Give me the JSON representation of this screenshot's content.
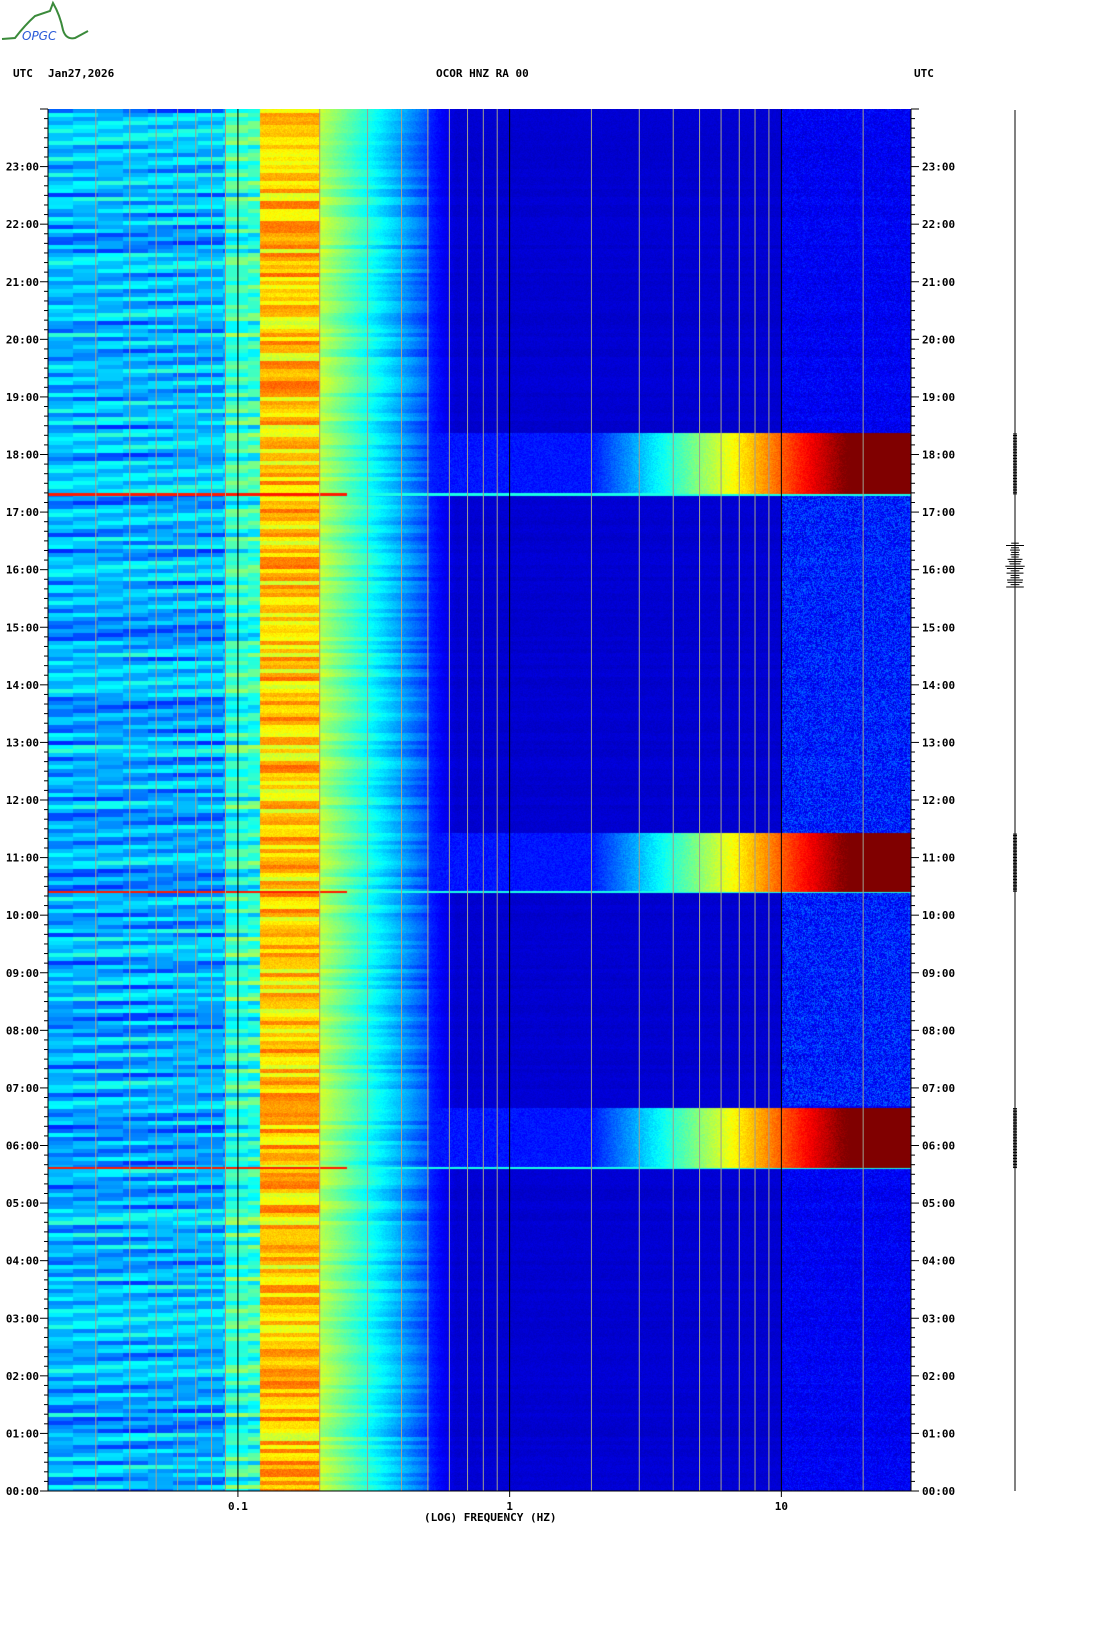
{
  "header": {
    "left_tz": "UTC",
    "date": "Jan27,2026",
    "station": "OCOR HNZ RA 00",
    "right_tz": "UTC"
  },
  "logo": {
    "text": "OPGC"
  },
  "chart_data": {
    "type": "heatmap",
    "title": "OCOR HNZ RA 00",
    "xlabel": "(LOG) FREQUENCY (HZ)",
    "ylabel": "UTC",
    "xscale": "log",
    "xlim": [
      0.02,
      30
    ],
    "ylim_hours": [
      0,
      24
    ],
    "x_tick_labels": [
      "0.1",
      "1",
      "10"
    ],
    "y_tick_labels": [
      "00:00",
      "01:00",
      "02:00",
      "03:00",
      "04:00",
      "05:00",
      "06:00",
      "07:00",
      "08:00",
      "09:00",
      "10:00",
      "11:00",
      "12:00",
      "13:00",
      "14:00",
      "15:00",
      "16:00",
      "17:00",
      "18:00",
      "19:00",
      "20:00",
      "21:00",
      "22:00",
      "23:00"
    ],
    "colormap": [
      "#00008f",
      "#0000ff",
      "#0080ff",
      "#00ffff",
      "#80ff80",
      "#ffff00",
      "#ff8000",
      "#ff0000",
      "#800000"
    ],
    "microseism_band_hz": [
      0.12,
      0.2
    ],
    "high_energy_events": [
      {
        "start": "05:37",
        "end": "06:40",
        "freq_from_hz": 2.0
      },
      {
        "start": "10:25",
        "end": "11:26",
        "freq_from_hz": 2.0
      },
      {
        "start": "17:19",
        "end": "18:23",
        "freq_from_hz": 2.0
      }
    ],
    "grid": true
  }
}
